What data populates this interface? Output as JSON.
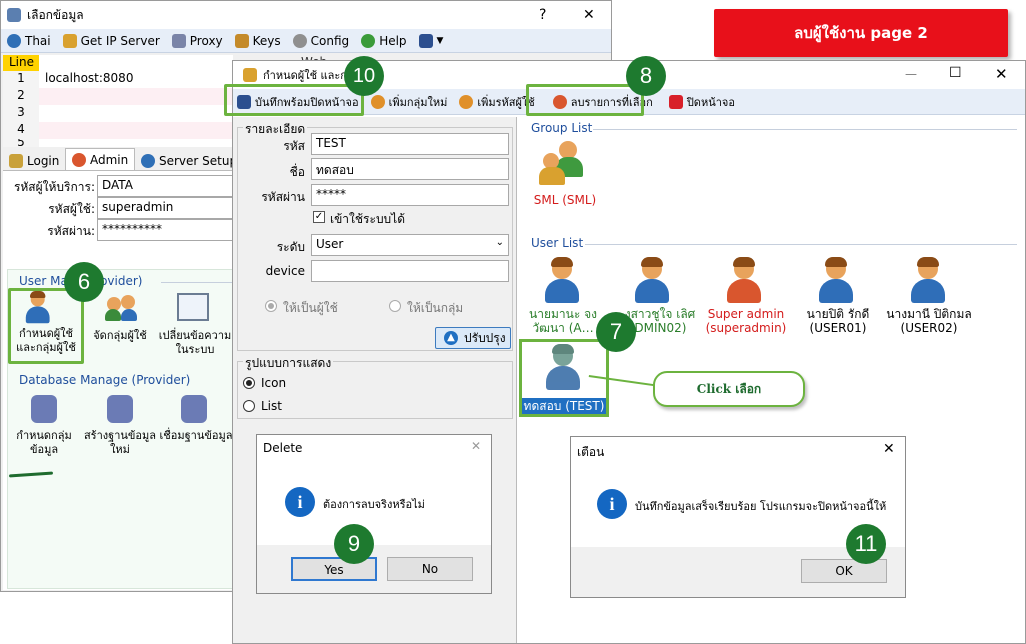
{
  "back_window": {
    "title": "เลือกข้อมูล",
    "help": "?",
    "close": "✕",
    "menu": [
      {
        "label": "Thai",
        "icon": "globe-icon"
      },
      {
        "label": "Get IP Server",
        "icon": "pin-icon"
      },
      {
        "label": "Proxy",
        "icon": "proxy-icon"
      },
      {
        "label": "Keys",
        "icon": "keys-icon"
      },
      {
        "label": "Config",
        "icon": "gear-icon"
      },
      {
        "label": "Help",
        "icon": "help-icon"
      }
    ],
    "line_header": "Line",
    "lines": [
      {
        "num": "1",
        "value": "localhost:8080"
      },
      {
        "num": "2",
        "value": ""
      },
      {
        "num": "3",
        "value": ""
      },
      {
        "num": "4",
        "value": ""
      },
      {
        "num": "5",
        "value": ""
      }
    ],
    "tabs": [
      "Login",
      "Admin",
      "Server Setup"
    ],
    "fields": [
      {
        "label": "รหัสผู้ให้บริการ:",
        "value": "DATA"
      },
      {
        "label": "รหัสผู้ใช้:",
        "value": "superadmin"
      },
      {
        "label": "รหัสผ่าน:",
        "value": "**********"
      }
    ],
    "user_manage_title": "User Ma… (Provider)",
    "user_manage_items": [
      "กำหนดผู้ใช้\nและกลุ่มผู้ใช้",
      "จัดกลุ่มผู้ใช้",
      "เปลี่ยนข้อความ\nในระบบ"
    ],
    "db_manage_title": "Database Manage (Provider)",
    "db_manage_items": [
      "กำหนดกลุ่ม\nข้อมูล",
      "สร้างฐานข้อมูล\nใหม่",
      "เชื่อมฐานข้อมูล"
    ],
    "behind_text": "Web…"
  },
  "banner": {
    "text": "ลบผู้ใช้งาน  page 2",
    "color": "#e8101a"
  },
  "user_window": {
    "title": "กำหนดผู้ใช้ และกลุ่ม",
    "toolbar": [
      {
        "label": "บันทึกพร้อมปิดหน้าจอ",
        "icon": "save-icon"
      },
      {
        "label": "เพิ่มกลุ่มใหม่",
        "icon": "add-group-icon"
      },
      {
        "label": "เพิ่มรหัสผู้ใช้",
        "icon": "add-user-icon"
      },
      {
        "label": "ลบรายการที่เลือก",
        "icon": "delete-user-icon"
      },
      {
        "label": "ปิดหน้าจอ",
        "icon": "close-red-icon"
      }
    ],
    "detail_title": "รายละเอียด",
    "code_label": "รหัส",
    "code_value": "TEST",
    "name_label": "ชื่อ",
    "name_value": "ทดสอบ",
    "password_label": "รหัสผ่าน",
    "password_value": "*****",
    "can_login_label": "เข้าใช้ระบบได้",
    "level_label": "ระดับ",
    "level_value": "User",
    "device_label": "device",
    "device_value": "",
    "radio_user": "ให้เป็นผู้ใช้",
    "radio_group": "ให้เป็นกลุ่ม",
    "update_button": "ปรับปรุง",
    "display_title": "รูปแบบการแสดง",
    "display_icon": "Icon",
    "display_list": "List",
    "group_list_title": "Group List",
    "groups": [
      {
        "label": "SML (SML)",
        "color": "#d41c1c"
      }
    ],
    "user_list_title": "User List",
    "users": [
      {
        "label": "นายมานะ จง\nวัฒนา (A…",
        "color": "#2a7d2a"
      },
      {
        "label": "…งสาวชูใจ เลิศ\n(ADMIN02)",
        "color": "#2a7d2a"
      },
      {
        "label": "Super admin\n(superadmin)",
        "color": "#d41c1c"
      },
      {
        "label": "นายปิติ รักดี\n(USER01)",
        "color": "#000000"
      },
      {
        "label": "นางมานี ปิติกมล\n(USER02)",
        "color": "#000000"
      }
    ],
    "selected_user": "ทดสอบ (TEST)",
    "click_note": "Click เลือก"
  },
  "delete_dialog": {
    "title": "Delete",
    "message": "ต้องการลบจริงหรือไม่",
    "yes": "Yes",
    "no": "No",
    "info": "i"
  },
  "alert_dialog": {
    "title": "เตือน",
    "message": "บันทึกข้อมูลเสร็จเรียบร้อย โปรแกรมจะปิดหน้าจอนี้ให้",
    "ok": "OK",
    "info": "i"
  },
  "steps": [
    "6",
    "7",
    "8",
    "9",
    "10",
    "11"
  ],
  "window_controls": {
    "min": "—",
    "max": "☐",
    "close": "✕"
  },
  "highlight_color": "#6cb33f"
}
